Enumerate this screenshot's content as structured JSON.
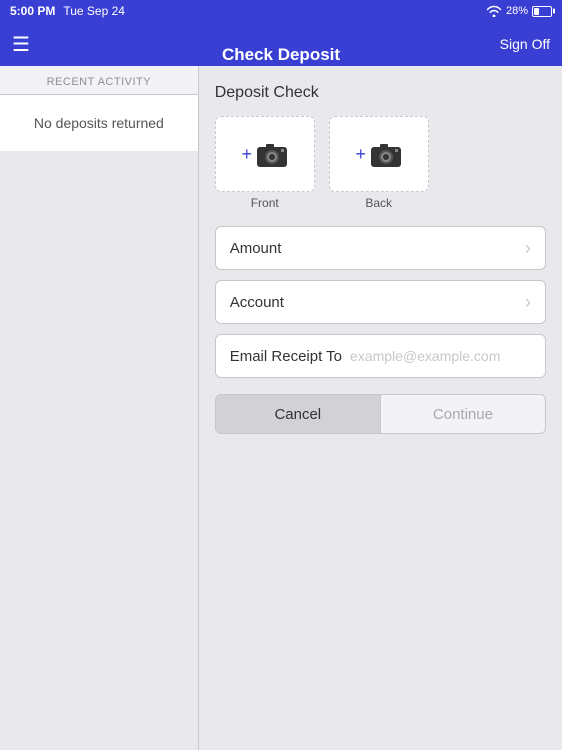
{
  "statusBar": {
    "time": "5:00 PM",
    "date": "Tue Sep 24",
    "battery": "28%"
  },
  "header": {
    "title": "Check Deposit",
    "signOffLabel": "Sign Off",
    "menuIcon": "☰"
  },
  "leftPanel": {
    "recentActivityLabel": "RECENT ACTIVITY",
    "noDepositsText": "No deposits returned"
  },
  "rightPanel": {
    "depositCheckTitle": "Deposit Check",
    "frontLabel": "Front",
    "backLabel": "Back",
    "plusSign": "+",
    "amountLabel": "Amount",
    "accountLabel": "Account",
    "emailReceiptLabel": "Email Receipt To",
    "emailPlaceholder": "example@example.com",
    "cancelLabel": "Cancel",
    "continueLabel": "Continue"
  }
}
